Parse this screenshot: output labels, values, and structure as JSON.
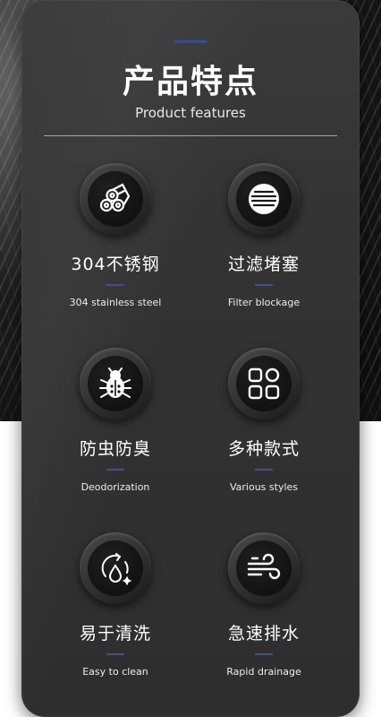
{
  "header": {
    "title": "产品特点",
    "subtitle": "Product features"
  },
  "features": [
    {
      "cn": "304不锈钢",
      "en": "304 stainless steel",
      "icon": "steel-pipes-icon"
    },
    {
      "cn": "过滤堵塞",
      "en": "Filter blockage",
      "icon": "filter-grate-icon"
    },
    {
      "cn": "防虫防臭",
      "en": "Deodorization",
      "icon": "bug-icon"
    },
    {
      "cn": "多种款式",
      "en": "Various styles",
      "icon": "grid-styles-icon"
    },
    {
      "cn": "易于清洗",
      "en": "Easy to clean",
      "icon": "water-drop-icon"
    },
    {
      "cn": "急速排水",
      "en": "Rapid drainage",
      "icon": "wind-flow-icon"
    }
  ],
  "colors": {
    "accent": "#3e4f92",
    "card": "#333333",
    "text": "#ffffff"
  }
}
